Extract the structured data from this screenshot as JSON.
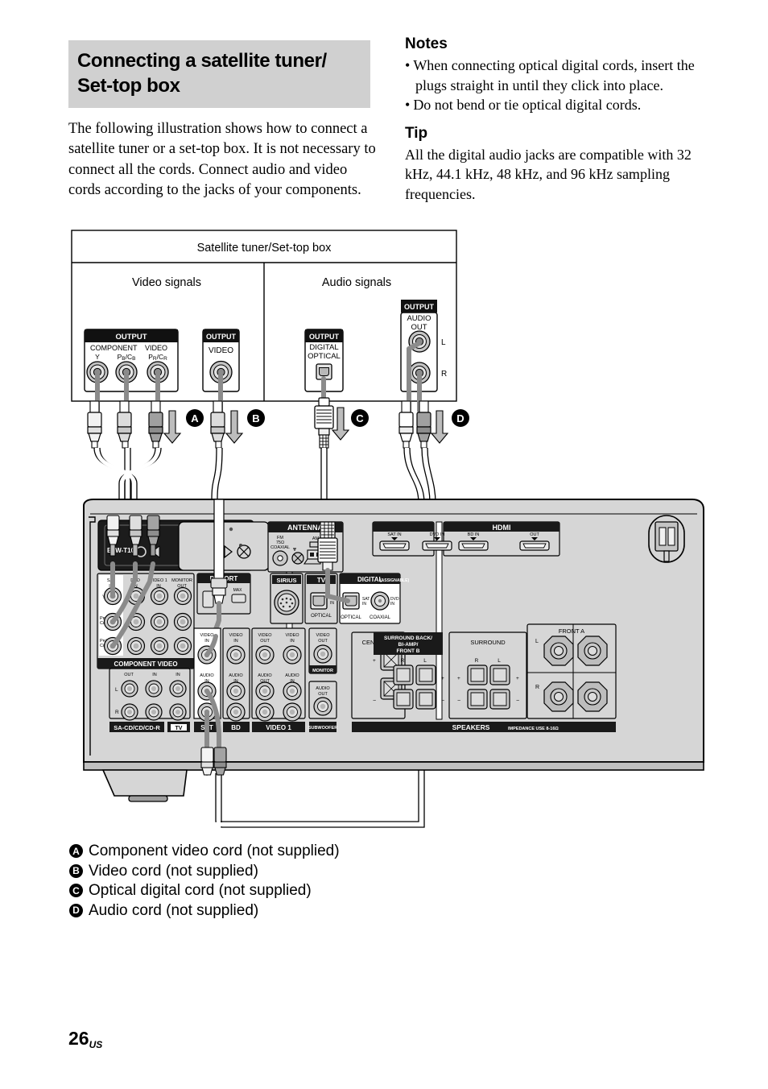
{
  "page": {
    "number": "26",
    "region_suffix": "US"
  },
  "section": {
    "title": "Connecting a satellite tuner/ Set-top box",
    "title_line1": "Connecting a satellite tuner/",
    "title_line2": "Set-top box",
    "intro": "The following illustration shows how to connect a satellite tuner or a set-top box. It is not necessary to connect all the cords. Connect audio and video cords according to the jacks of your components."
  },
  "notes": {
    "heading": "Notes",
    "items": [
      "When connecting optical digital cords, insert the plugs straight in until they click into place.",
      "Do not bend or tie optical digital cords."
    ]
  },
  "tip": {
    "heading": "Tip",
    "text": "All the digital audio jacks are compatible with 32 kHz, 44.1 kHz, 48 kHz, and 96 kHz sampling frequencies."
  },
  "device": {
    "title": "Satellite tuner/Set-top box",
    "video_section_label": "Video signals",
    "audio_section_label": "Audio signals",
    "jacks": {
      "component": {
        "output_label": "OUTPUT",
        "group_label_1": "COMPONENT",
        "group_label_2": "VIDEO",
        "y": "Y",
        "pb": "PB/CB",
        "pr": "PR/CR"
      },
      "video": {
        "output_label": "OUTPUT",
        "label": "VIDEO"
      },
      "digital_optical": {
        "output_label": "OUTPUT",
        "line1": "DIGITAL",
        "line2": "OPTICAL"
      },
      "audio_out": {
        "output_label": "OUTPUT",
        "line1": "AUDIO",
        "line2": "OUT",
        "left": "L",
        "right": "R"
      }
    }
  },
  "cords": [
    {
      "letter": "A",
      "name": "Component video cord (not supplied)"
    },
    {
      "letter": "B",
      "name": "Video cord (not supplied)"
    },
    {
      "letter": "C",
      "name": "Optical digital cord (not supplied)"
    },
    {
      "letter": "D",
      "name": "Audio cord (not supplied)"
    }
  ],
  "receiver": {
    "ezw": "EZW-T100",
    "dmport": "DMPORT",
    "dmport_max": "MAX",
    "antenna": {
      "title": "ANTENNA",
      "fm": "FM",
      "fm_ohm": "75Ω",
      "fm_coaxial": "COAXIAL",
      "am": "AM"
    },
    "hdmi": {
      "title": "HDMI",
      "sat_in": "SAT IN",
      "dvd_in": "DVD IN",
      "bd_in": "BD IN",
      "out": "OUT"
    },
    "sirius": "SIRIUS",
    "tv_optical": {
      "title": "TV",
      "in": "IN",
      "optical": "OPTICAL"
    },
    "digital": {
      "title": "DIGITAL",
      "assignable": "(ASSIGNABLE)",
      "sat_in": "SAT IN",
      "optical": "OPTICAL",
      "dvd_in": "DVD IN",
      "coaxial": "COAXIAL"
    },
    "component_video": {
      "title": "COMPONENT VIDEO",
      "columns": [
        "SAT IN",
        "DVD IN",
        "VIDEO 1 IN",
        "MONITOR OUT"
      ],
      "rows": [
        "Y",
        "PB/CB",
        "PR/CR"
      ]
    },
    "audio_block": {
      "lr": [
        "L",
        "R"
      ],
      "groups": [
        {
          "name": "SA-CD/CD/CD-R",
          "sublabels": [
            "OUT",
            "IN"
          ]
        },
        {
          "name": "TV",
          "sublabels": [
            "IN"
          ]
        }
      ]
    },
    "av_columns": [
      {
        "name": "SAT",
        "video": "VIDEO IN",
        "audio": "AUDIO IN"
      },
      {
        "name": "BD",
        "video": "VIDEO IN",
        "audio": "AUDIO IN"
      },
      {
        "name": "VIDEO 1",
        "video_out": "VIDEO OUT",
        "video_in": "VIDEO IN",
        "audio_out": "AUDIO OUT",
        "audio_in": "AUDIO IN"
      }
    ],
    "monitor": {
      "video_out": "VIDEO OUT",
      "label": "MONITOR"
    },
    "subwoofer": {
      "audio_out": "AUDIO OUT",
      "label": "SUBWOOFER"
    },
    "speakers": {
      "title": "SPEAKERS",
      "impedance": "IMPEDANCE USE 8-16Ω",
      "center": "CENTER",
      "surround_back": "SURROUND BACK/ BI-AMP/ FRONT B",
      "surround_back_l1": "SURROUND BACK/",
      "surround_back_l2": "BI-AMP/",
      "surround_back_l3": "FRONT B",
      "surround": "SURROUND",
      "front_a": "FRONT A",
      "plus": "+",
      "minus": "−",
      "l": "L",
      "r": "R"
    }
  },
  "colors": {
    "heading_band": "#d0d0d0",
    "panel_body": "#d4d4d4",
    "panel_dark": "#1a1a1a",
    "cord_gray": "#8c8c8c",
    "cord_light": "#e8e8e8",
    "jack_fill": "#c9c9c9"
  }
}
